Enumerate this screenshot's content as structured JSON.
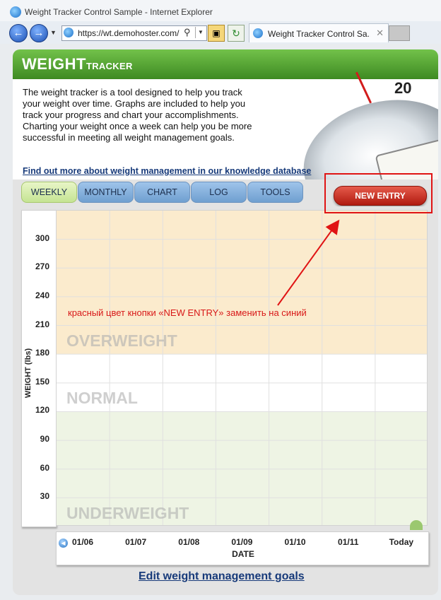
{
  "browser": {
    "window_title": "Weight Tracker Control Sample - Internet Explorer",
    "address_url": "https://wt.demohoster.com/",
    "tab_title": "Weight Tracker Control Sa..."
  },
  "widget": {
    "brand_bold": "WEIGHT",
    "brand_small": "TRACKER",
    "intro_text": "The weight tracker is a tool designed to help you track your weight over time. Graphs are included to help you track your progress and chart your accomplishments. Charting your weight once a week can help you be more successful in meeting all weight management goals.",
    "learn_more_link": "Find out more about weight management in our knowledge database",
    "scale_number": "20",
    "tabs": [
      {
        "label": "WEEKLY",
        "active": true
      },
      {
        "label": "MONTHLY",
        "active": false
      },
      {
        "label": "CHART",
        "active": false
      },
      {
        "label": "LOG",
        "active": false
      },
      {
        "label": "TOOLS",
        "active": false
      }
    ],
    "new_entry_label": "NEW ENTRY",
    "edit_goals_link": "Edit weight management goals"
  },
  "annotation": {
    "text": "красный цвет кнопки «NEW ENTRY» заменить на синий",
    "color": "#e01414"
  },
  "colors": {
    "header_green": "#4f9f2c",
    "overweight_band": "#fbebcd",
    "normal_band": "#ffffff",
    "underweight_band": "#eef4e4",
    "new_entry_red": "#c62a1c"
  },
  "chart_data": {
    "type": "line",
    "title": "",
    "xlabel": "DATE",
    "ylabel": "WEIGHT (lbs)",
    "categories": [
      "01/06",
      "01/07",
      "01/08",
      "01/09",
      "01/10",
      "01/11",
      "Today"
    ],
    "y_ticks": [
      30,
      60,
      90,
      120,
      150,
      180,
      210,
      240,
      270,
      300
    ],
    "ylim": [
      0,
      330
    ],
    "series": [],
    "zones": [
      {
        "label": "OVERWEIGHT",
        "from": 180,
        "to": 330
      },
      {
        "label": "NORMAL",
        "from": 120,
        "to": 180
      },
      {
        "label": "UNDERWEIGHT",
        "from": 0,
        "to": 120
      }
    ],
    "grid": true
  }
}
